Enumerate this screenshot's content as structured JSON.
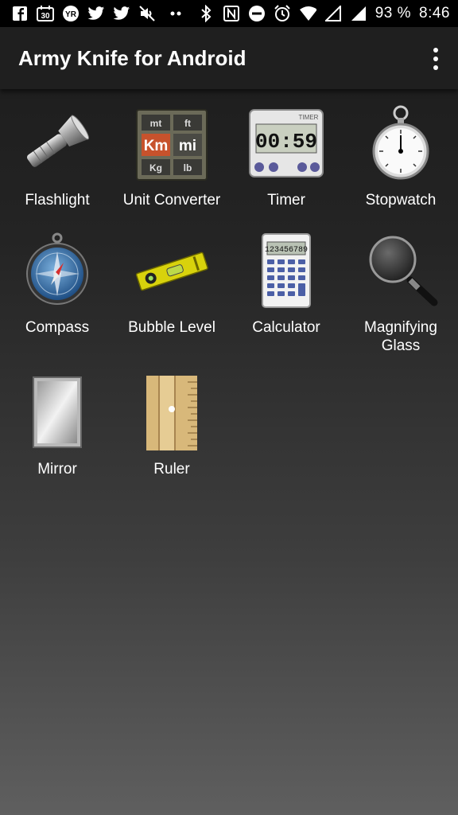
{
  "status_bar": {
    "battery": "93 %",
    "time": "8:46",
    "left_icons": [
      "facebook-icon",
      "calendar-30-icon",
      "yr-icon",
      "twitter-icon",
      "twitter-icon",
      "mute-icon",
      "more-dots-icon"
    ],
    "right_icons": [
      "bluetooth-icon",
      "nfc-icon",
      "do-not-disturb-icon",
      "alarm-icon",
      "wifi-icon",
      "signal-icon",
      "signal-icon"
    ]
  },
  "app_bar": {
    "title": "Army Knife for Android"
  },
  "tools": [
    {
      "label": "Flashlight"
    },
    {
      "label": "Unit Converter"
    },
    {
      "label": "Timer"
    },
    {
      "label": "Stopwatch"
    },
    {
      "label": "Compass"
    },
    {
      "label": "Bubble Level"
    },
    {
      "label": "Calculator"
    },
    {
      "label": "Magnifying Glass"
    },
    {
      "label": "Mirror"
    },
    {
      "label": "Ruler"
    }
  ],
  "icon_text": {
    "converter": [
      "mt",
      "ft",
      "Km",
      "mi",
      "Kg",
      "lb"
    ],
    "timer_top": "TIMER",
    "timer_display": "00:59",
    "calc_display": "123456789"
  }
}
